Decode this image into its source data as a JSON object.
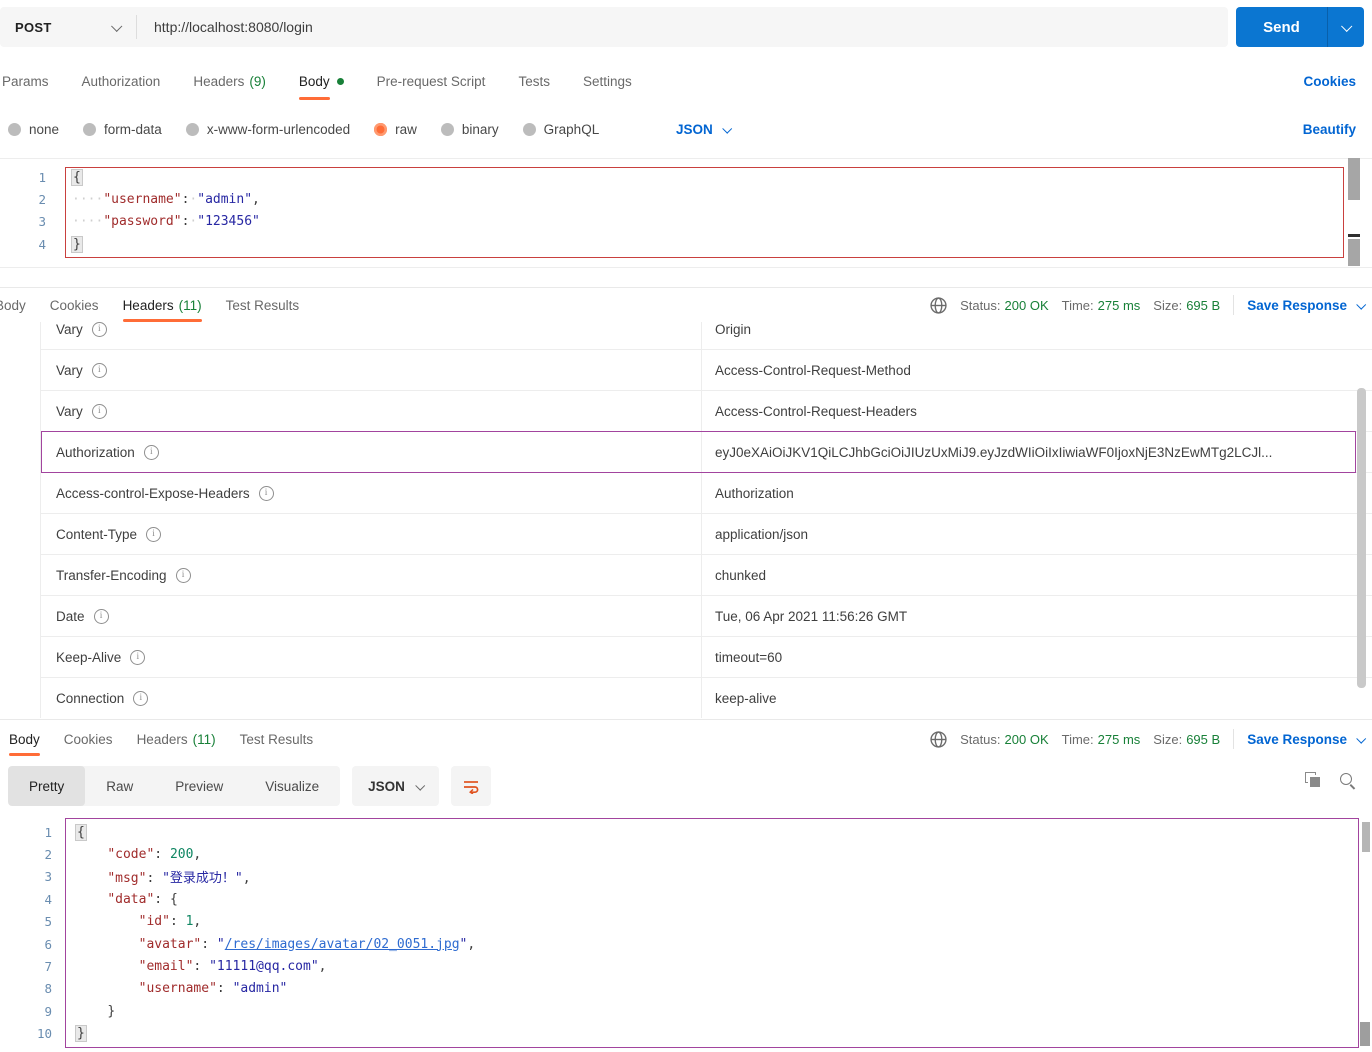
{
  "colors": {
    "accent-orange": "#ff6c37",
    "link-blue": "#0265d2",
    "send-blue": "#0b76d1",
    "success-green": "#188038",
    "annotation-red": "#c9403e",
    "annotation-purple": "#a2449e",
    "code-key": "#a02c2c",
    "code-string": "#2727a3",
    "code-number": "#0f8662",
    "code-link": "#2e6bd0",
    "line-number": "#6a8db0"
  },
  "request": {
    "method": "POST",
    "url": "http://localhost:8080/login",
    "send_label": "Send",
    "cookies_link": "Cookies",
    "beautify_link": "Beautify",
    "language": "JSON",
    "tabs": [
      {
        "label": "Params"
      },
      {
        "label": "Authorization"
      },
      {
        "label": "Headers",
        "count": "(9)"
      },
      {
        "label": "Body",
        "active": true,
        "dot": true
      },
      {
        "label": "Pre-request Script"
      },
      {
        "label": "Tests"
      },
      {
        "label": "Settings"
      }
    ],
    "body_modes": [
      {
        "label": "none"
      },
      {
        "label": "form-data"
      },
      {
        "label": "x-www-form-urlencoded"
      },
      {
        "label": "raw",
        "selected": true
      },
      {
        "label": "binary"
      },
      {
        "label": "GraphQL"
      }
    ],
    "body_lines": [
      {
        "num": "1",
        "tokens": [
          {
            "c": "brace",
            "t": "{"
          }
        ]
      },
      {
        "num": "2",
        "tokens": [
          {
            "c": "ws",
            "t": "····"
          },
          {
            "c": "key",
            "t": "\"username\""
          },
          {
            "c": "punc",
            "t": ":"
          },
          {
            "c": "ws",
            "t": "·"
          },
          {
            "c": "str",
            "t": "\"admin\""
          },
          {
            "c": "punc",
            "t": ","
          }
        ]
      },
      {
        "num": "3",
        "tokens": [
          {
            "c": "ws",
            "t": "····"
          },
          {
            "c": "key",
            "t": "\"password\""
          },
          {
            "c": "punc",
            "t": ":"
          },
          {
            "c": "ws",
            "t": "·"
          },
          {
            "c": "str",
            "t": "\"123456\""
          }
        ]
      },
      {
        "num": "4",
        "tokens": [
          {
            "c": "brace",
            "t": "}"
          }
        ]
      }
    ]
  },
  "response_headers_pane": {
    "tabs": [
      {
        "label": "Body"
      },
      {
        "label": "Cookies"
      },
      {
        "label": "Headers",
        "count": "(11)",
        "active": true
      },
      {
        "label": "Test Results"
      }
    ],
    "status": {
      "status_label": "Status:",
      "status_value": "200 OK",
      "time_label": "Time:",
      "time_value": "275 ms",
      "size_label": "Size:",
      "size_value": "695 B",
      "save_label": "Save Response"
    },
    "table": [
      {
        "key": "Vary",
        "value": "Origin"
      },
      {
        "key": "Vary",
        "value": "Access-Control-Request-Method"
      },
      {
        "key": "Vary",
        "value": "Access-Control-Request-Headers"
      },
      {
        "key": "Authorization",
        "value": "eyJ0eXAiOiJKV1QiLCJhbGciOiJIUzUxMiJ9.eyJzdWIiOiIxIiwiaWF0IjoxNjE3NzEwMTg2LCJl...",
        "highlighted": true
      },
      {
        "key": "Access-control-Expose-Headers",
        "value": "Authorization"
      },
      {
        "key": "Content-Type",
        "value": "application/json"
      },
      {
        "key": "Transfer-Encoding",
        "value": "chunked"
      },
      {
        "key": "Date",
        "value": "Tue, 06 Apr 2021 11:56:26 GMT"
      },
      {
        "key": "Keep-Alive",
        "value": "timeout=60"
      },
      {
        "key": "Connection",
        "value": "keep-alive"
      }
    ]
  },
  "response_body_pane": {
    "tabs": [
      {
        "label": "Body",
        "active": true
      },
      {
        "label": "Cookies"
      },
      {
        "label": "Headers",
        "count": "(11)"
      },
      {
        "label": "Test Results"
      }
    ],
    "status": {
      "status_label": "Status:",
      "status_value": "200 OK",
      "time_label": "Time:",
      "time_value": "275 ms",
      "size_label": "Size:",
      "size_value": "695 B",
      "save_label": "Save Response"
    },
    "view_modes": [
      {
        "label": "Pretty",
        "active": true
      },
      {
        "label": "Raw"
      },
      {
        "label": "Preview"
      },
      {
        "label": "Visualize"
      }
    ],
    "language": "JSON",
    "body_lines": [
      {
        "num": "1",
        "tokens": [
          {
            "c": "brace",
            "t": "{"
          }
        ]
      },
      {
        "num": "2",
        "tokens": [
          {
            "c": "sp",
            "t": "    "
          },
          {
            "c": "key",
            "t": "\"code\""
          },
          {
            "c": "punc",
            "t": ": "
          },
          {
            "c": "num",
            "t": "200"
          },
          {
            "c": "punc",
            "t": ","
          }
        ]
      },
      {
        "num": "3",
        "tokens": [
          {
            "c": "sp",
            "t": "    "
          },
          {
            "c": "key",
            "t": "\"msg\""
          },
          {
            "c": "punc",
            "t": ": "
          },
          {
            "c": "str",
            "t": "\"登录成功！\""
          },
          {
            "c": "punc",
            "t": ","
          }
        ]
      },
      {
        "num": "4",
        "tokens": [
          {
            "c": "sp",
            "t": "    "
          },
          {
            "c": "key",
            "t": "\"data\""
          },
          {
            "c": "punc",
            "t": ": "
          },
          {
            "c": "brace2",
            "t": "{"
          }
        ]
      },
      {
        "num": "5",
        "tokens": [
          {
            "c": "sp",
            "t": "        "
          },
          {
            "c": "key",
            "t": "\"id\""
          },
          {
            "c": "punc",
            "t": ": "
          },
          {
            "c": "num",
            "t": "1"
          },
          {
            "c": "punc",
            "t": ","
          }
        ]
      },
      {
        "num": "6",
        "tokens": [
          {
            "c": "sp",
            "t": "        "
          },
          {
            "c": "key",
            "t": "\"avatar\""
          },
          {
            "c": "punc",
            "t": ": "
          },
          {
            "c": "str",
            "t": "\""
          },
          {
            "c": "link",
            "t": "/res/images/avatar/02_0051.jpg"
          },
          {
            "c": "str",
            "t": "\""
          },
          {
            "c": "punc",
            "t": ","
          }
        ]
      },
      {
        "num": "7",
        "tokens": [
          {
            "c": "sp",
            "t": "        "
          },
          {
            "c": "key",
            "t": "\"email\""
          },
          {
            "c": "punc",
            "t": ": "
          },
          {
            "c": "str",
            "t": "\"11111@qq.com\""
          },
          {
            "c": "punc",
            "t": ","
          }
        ]
      },
      {
        "num": "8",
        "tokens": [
          {
            "c": "sp",
            "t": "        "
          },
          {
            "c": "key",
            "t": "\"username\""
          },
          {
            "c": "punc",
            "t": ": "
          },
          {
            "c": "str",
            "t": "\"admin\""
          }
        ]
      },
      {
        "num": "9",
        "tokens": [
          {
            "c": "sp",
            "t": "    "
          },
          {
            "c": "brace2",
            "t": "}"
          }
        ]
      },
      {
        "num": "10",
        "tokens": [
          {
            "c": "brace",
            "t": "}"
          }
        ]
      }
    ]
  }
}
